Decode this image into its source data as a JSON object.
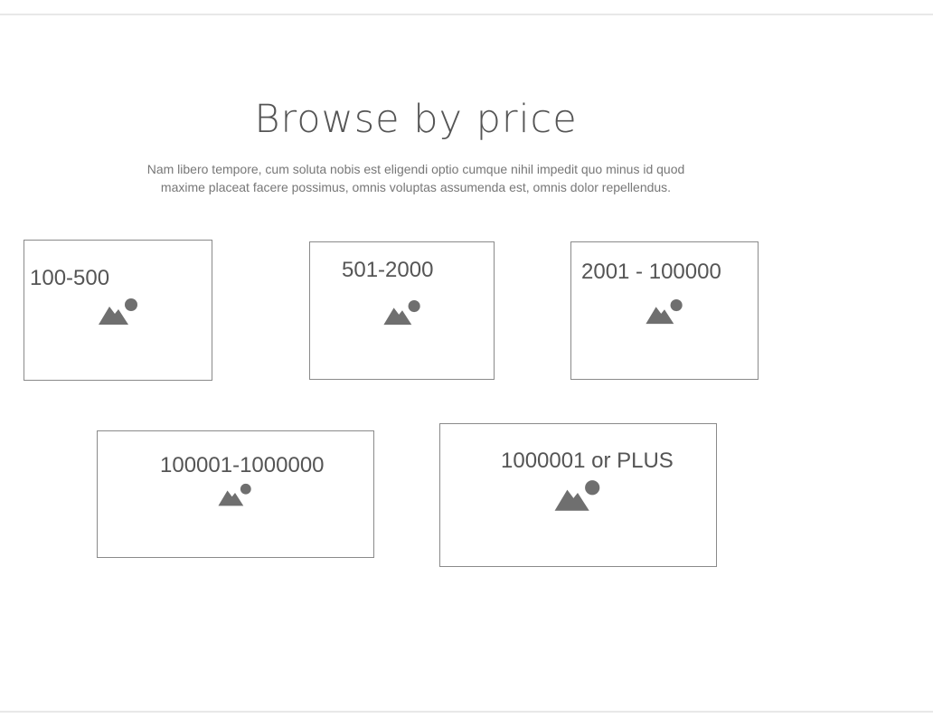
{
  "section": {
    "title": "Browse by price",
    "description": "Nam libero tempore, cum soluta nobis est eligendi optio cumque nihil impedit quo minus id quod maxime placeat facere possimus, omnis voluptas assumenda est, omnis dolor repellendus."
  },
  "price_cards": [
    {
      "label": "100-500",
      "icon": "image-placeholder-icon"
    },
    {
      "label": "501-2000",
      "icon": "image-placeholder-icon"
    },
    {
      "label": "2001 - 100000",
      "icon": "image-placeholder-icon"
    },
    {
      "label": "100001-1000000",
      "icon": "image-placeholder-icon"
    },
    {
      "label": "1000001 or PLUS",
      "icon": "image-placeholder-icon"
    }
  ],
  "colors": {
    "text": "#555555",
    "icon": "#6f6f6f",
    "border": "#8a8a8a",
    "rule": "#e8e8e8"
  }
}
